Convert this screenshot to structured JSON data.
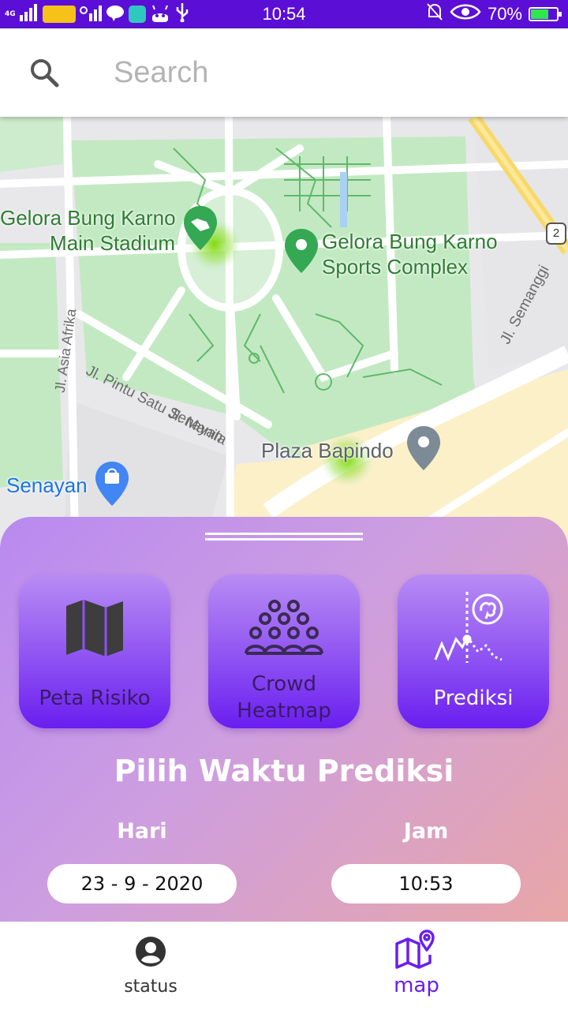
{
  "status_bar": {
    "time": "10:54",
    "battery_text": "70%",
    "battery_level": 0.7,
    "network_label": "4G"
  },
  "search": {
    "placeholder": "Search",
    "value": ""
  },
  "map": {
    "labels": {
      "stadium": [
        "Gelora Bung Karno",
        "Main Stadium"
      ],
      "sports_complex": [
        "Gelora Bung Karno",
        "Sports Complex"
      ],
      "plaza": "Plaza Bapindo",
      "senayan": "Senayan",
      "street_afrika": "Jl. Asia Afrika",
      "street_pintu": "Jl. Pintu Satu Senayan",
      "street_manila": "Jl. Manila",
      "street_semanggi": "Jl. Semanggi",
      "road_shield": "2"
    }
  },
  "sheet": {
    "features": [
      {
        "label": "Peta Risiko",
        "icon": "map-icon",
        "active": false
      },
      {
        "label": "Crowd Heatmap",
        "icon": "crowd-icon",
        "active": false
      },
      {
        "label": "Prediksi",
        "icon": "prediction-icon",
        "active": true
      }
    ],
    "title": "Pilih Waktu Prediksi",
    "day_label": "Hari",
    "day_value": "23 - 9 - 2020",
    "hour_label": "Jam",
    "hour_value": "10:53"
  },
  "nav": {
    "items": [
      {
        "label": "status",
        "icon": "account-icon",
        "active": false
      },
      {
        "label": "map",
        "icon": "map-pin-icon",
        "active": true
      }
    ]
  },
  "colors": {
    "status_bar": "#5b0fd6",
    "accent": "#6a1ef0",
    "nav_active": "#6a1ef0",
    "nav_inactive": "#333333",
    "park_green": "#bfe8c0",
    "poi_green": "#34a853",
    "poi_blue": "#4285f4"
  }
}
